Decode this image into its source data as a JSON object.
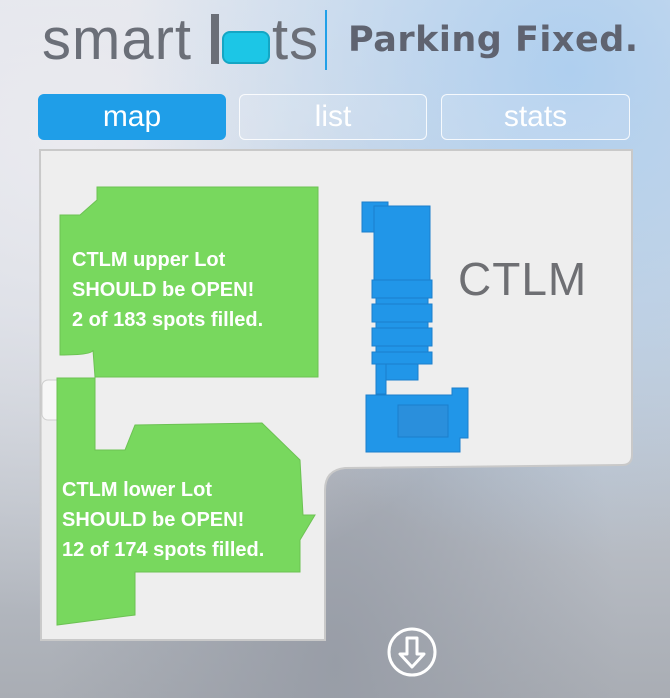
{
  "header": {
    "logo_text_left": "smart",
    "logo_text_right": "ts",
    "tagline": "Parking Fixed."
  },
  "tabs": [
    {
      "label": "map",
      "active": true
    },
    {
      "label": "list",
      "active": false
    },
    {
      "label": "stats",
      "active": false
    }
  ],
  "map": {
    "building_label": "CTLM",
    "lots": [
      {
        "name": "CTLM upper Lot",
        "status": "SHOULD be OPEN!",
        "spots": "2 of 183 spots filled.",
        "color": "#78d85e"
      },
      {
        "name": "CTLM lower Lot",
        "status": "SHOULD be OPEN!",
        "spots": "12 of 174 spots filled.",
        "color": "#78d85e"
      }
    ],
    "building_color": "#2196e8",
    "ground_color": "#eeeeee"
  },
  "colors": {
    "accent": "#1f9ee8",
    "logo_box": "#1cc6e6"
  },
  "icons": {
    "scroll_down": "arrow-down-circle-icon"
  }
}
